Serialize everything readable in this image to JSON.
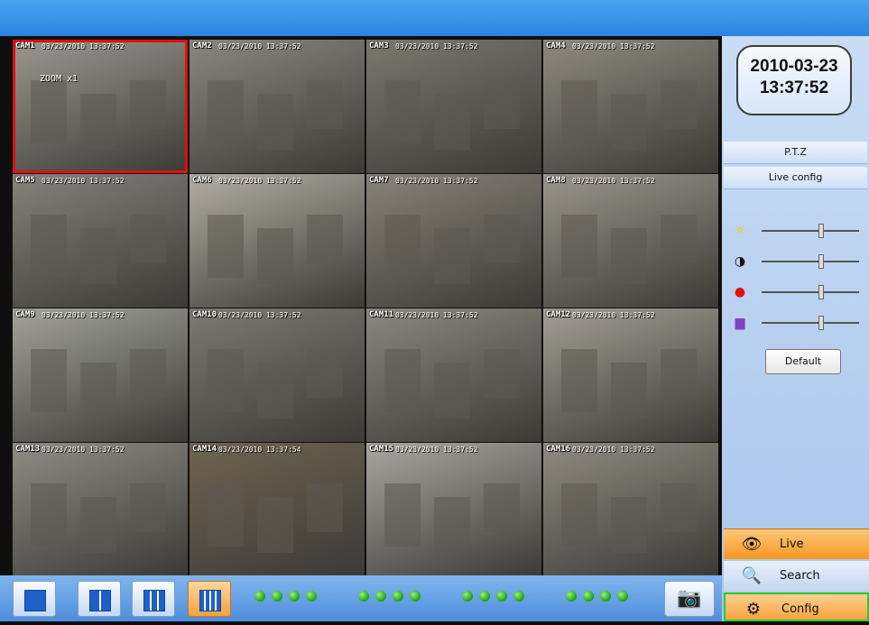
{
  "cameras": [
    {
      "label": "CAM1",
      "time": "03/23/2010 13:37:52",
      "bg": "#9c9890",
      "selected": true,
      "overlay": "ZOOM x1"
    },
    {
      "label": "CAM2",
      "time": "03/23/2010 13:37:52",
      "bg": "#8a877f"
    },
    {
      "label": "CAM3",
      "time": "03/23/2010 13:37:52",
      "bg": "#7b786f"
    },
    {
      "label": "CAM4",
      "time": "03/23/2010 13:37:52",
      "bg": "#8e8a80"
    },
    {
      "label": "CAM5",
      "time": "03/23/2010 13:37:52",
      "bg": "#85827a"
    },
    {
      "label": "CAM6",
      "time": "03/23/2010 13:37:52",
      "bg": "#b2aea2"
    },
    {
      "label": "CAM7",
      "time": "03/23/2010 13:37:52",
      "bg": "#888378"
    },
    {
      "label": "CAM8",
      "time": "03/23/2010 13:37:52",
      "bg": "#9a968c"
    },
    {
      "label": "CAM9",
      "time": "03/23/2010 13:37:52",
      "bg": "#a3a39c"
    },
    {
      "label": "CAM10",
      "time": "03/23/2010 13:37:52",
      "bg": "#7d7a72"
    },
    {
      "label": "CAM11",
      "time": "03/23/2010 13:37:52",
      "bg": "#8b887f"
    },
    {
      "label": "CAM12",
      "time": "03/23/2010 13:37:52",
      "bg": "#a29e94"
    },
    {
      "label": "CAM13",
      "time": "03/23/2010 13:37:52",
      "bg": "#8f8c84"
    },
    {
      "label": "CAM14",
      "time": "03/23/2010 13:37:54",
      "bg": "#6f6451"
    },
    {
      "label": "CAM15",
      "time": "03/23/2010 13:37:52",
      "bg": "#a9a69e"
    },
    {
      "label": "CAM16",
      "time": "03/23/2010 13:37:52",
      "bg": "#8f8b80"
    }
  ],
  "clock": {
    "date": "2010-03-23",
    "time": "13:37:52"
  },
  "panel": {
    "ptz": "P.T.Z",
    "live_config": "Live config",
    "default_label": "Default"
  },
  "sliders": [
    {
      "name": "brightness",
      "icon": "sun-icon",
      "glyph": "☼",
      "color": "#e8c800",
      "value": 0.6
    },
    {
      "name": "contrast",
      "icon": "contrast-icon",
      "glyph": "◑",
      "color": "#000000",
      "value": 0.6
    },
    {
      "name": "saturation",
      "icon": "color-balls-icon",
      "glyph": "●",
      "color": "#e01010",
      "value": 0.6
    },
    {
      "name": "hue",
      "icon": "hue-icon",
      "glyph": "▆",
      "color": "#8040c0",
      "value": 0.6
    }
  ],
  "nav": {
    "live": "Live",
    "search": "Search",
    "config": "Config"
  },
  "channel_dots": 16,
  "colors": {
    "selected_border": "#e01010",
    "accent_orange": "#f59722",
    "config_border": "#2ccc2c"
  }
}
